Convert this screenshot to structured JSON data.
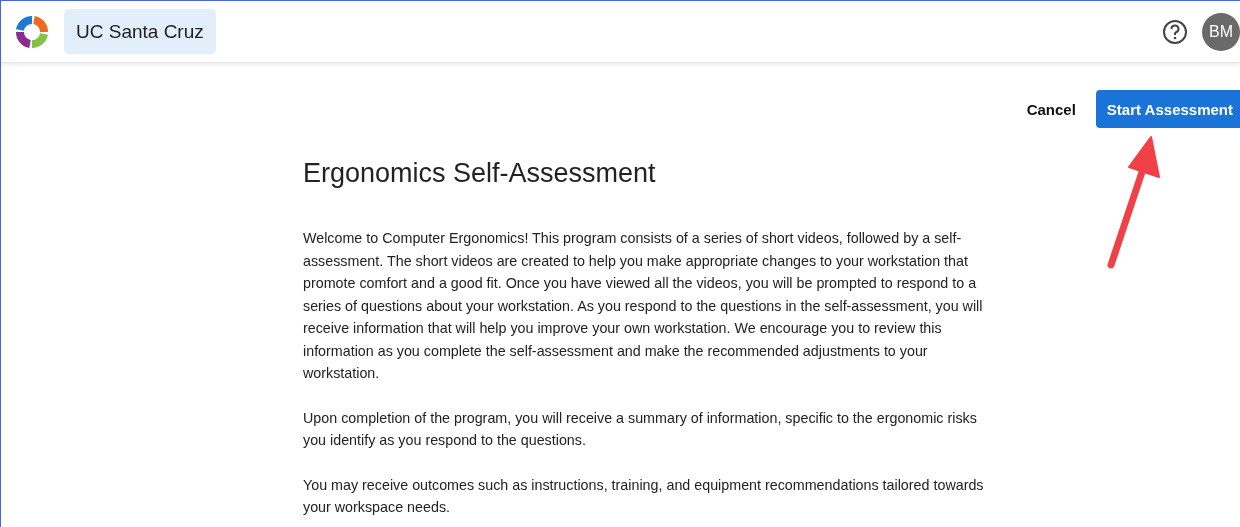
{
  "header": {
    "organization": "UC Santa Cruz",
    "avatar_initials": "BM"
  },
  "actions": [
    {
      "label": "Cancel",
      "kind": "text"
    },
    {
      "label": "Start Assessment",
      "kind": "primary"
    }
  ],
  "article": {
    "title": "Ergonomics Self-Assessment",
    "paragraphs": [
      "Welcome to Computer Ergonomics! This program consists of a series of short videos, followed by a self-assessment. The short videos are created to help you make appropriate changes to your workstation that promote comfort and a good fit. Once you have viewed all the videos, you will be prompted to respond to a series of questions about your workstation. As you respond to the questions in the self-assessment, you will receive information that will help you improve your own workstation. We encourage you to review this information as you complete the self-assessment and make the recommended adjustments to your workstation.",
      "Upon completion of the program, you will receive a summary of information, specific to the ergonomic risks you identify as you respond to the questions.",
      "You may receive outcomes such as instructions, training, and equipment recommendations tailored towards your workspace needs."
    ]
  }
}
